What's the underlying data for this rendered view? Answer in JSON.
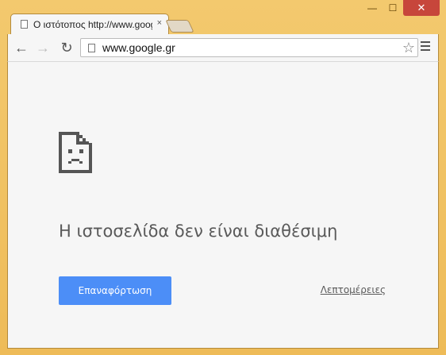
{
  "window": {
    "minimize_glyph": "—",
    "maximize_glyph": "☐",
    "close_glyph": "✕"
  },
  "tab": {
    "title": "Ο ιστότοπος http://www.google.gr",
    "close_glyph": "×",
    "icon": "page-icon"
  },
  "toolbar": {
    "back_glyph": "←",
    "forward_glyph": "→",
    "reload_glyph": "↻",
    "url": "www.google.gr",
    "star_glyph": "☆",
    "menu_icon": "hamburger-menu-icon"
  },
  "error_page": {
    "icon": "sad-page-icon",
    "title": "Η ιστοσελίδα δεν είναι διαθέσιμη",
    "reload_label": "Επαναφόρτωση",
    "details_label": "Λεπτομέρειες"
  },
  "colors": {
    "frame": "#f0c064",
    "accent_button": "#4c8ef7",
    "close_button": "#c7463b"
  }
}
